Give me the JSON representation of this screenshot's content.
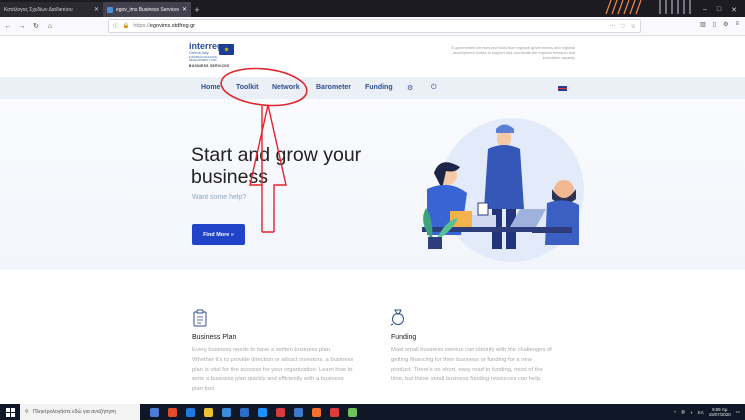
{
  "browser": {
    "tabs": [
      {
        "label": "Κατάλογος Σχεδίων Διαδικτύου",
        "active": false
      },
      {
        "label": "egov_ims Business Services",
        "active": true
      }
    ],
    "url": {
      "protocol": "https://",
      "host": "egovims.stdfreg.gr"
    },
    "window_controls": [
      "–",
      "□",
      "✕"
    ]
  },
  "site": {
    "logo": {
      "brand": "interreg",
      "sub": "Greece-Italy",
      "sub2": "EUROPEAN REGIONAL DEVELOPMENT FUND",
      "service": "BUSINESS SERVICES"
    },
    "tagline": "E-government services and tools from regional governments and regional development bodies to support and coordinate the regional research and innovation capacity",
    "nav": [
      {
        "label": "Home"
      },
      {
        "label": "Toolkit"
      },
      {
        "label": "Network"
      },
      {
        "label": "Barometer"
      },
      {
        "label": "Funding"
      }
    ],
    "nav_icons": [
      "gear-icon",
      "power-icon"
    ],
    "language_flag": "uk-flag"
  },
  "hero": {
    "title": "Start and grow your business",
    "subtitle": "Want some help?",
    "button": "Find More »"
  },
  "features": [
    {
      "icon": "clipboard-icon",
      "title": "Business Plan",
      "text": "Every business needs to have a written business plan. Whether it's to provide direction or attract investors, a business plan is vital for the success for your organization. Learn how to write a business plan quickly and efficiently with a business plan tool."
    },
    {
      "icon": "moneybag-icon",
      "title": "Funding",
      "text": "Most small business owners can identify with the challenges of getting financing for their business or funding for a new product. There's no short, easy road to funding, most of the time, but these small business funding resources can help."
    }
  ],
  "taskbar": {
    "search_placeholder": "Πληκτρολογήστε εδώ για αναζήτηση",
    "language": "ΕΛ",
    "time": "9:59 πμ",
    "date": "15/07/2020"
  },
  "colors": {
    "accent": "#2143c8",
    "nav_text": "#2f4f8f",
    "annotation": "#e0252b"
  }
}
